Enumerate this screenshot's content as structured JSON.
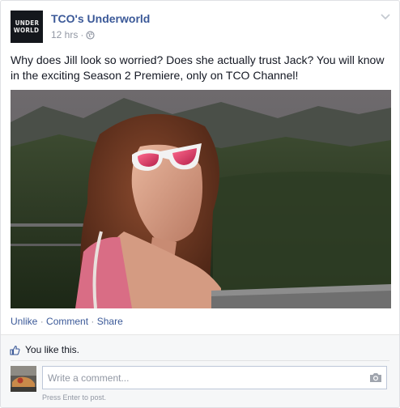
{
  "post": {
    "page_name": "TCO's Underworld",
    "avatar_text_line1": "UNDER",
    "avatar_text_line2": "WORLD",
    "timestamp": "12 hrs",
    "meta_separator": "·",
    "privacy_icon": "globe-icon",
    "text": "Why does Jill look so worried? Does she actually trust Jack? You will know in the exciting Season 2 Premiere, only on TCO Channel!",
    "photo_icon": "photo-woman-sunglasses"
  },
  "actions": {
    "unlike": "Unlike",
    "sep": "·",
    "comment": "Comment",
    "share": "Share"
  },
  "ufi": {
    "likes_text": "You like this.",
    "comment_placeholder": "Write a comment...",
    "hint": "Press Enter to post."
  },
  "colors": {
    "link": "#3b5998",
    "meta": "#9197a3",
    "ufi_bg": "#f6f7f8",
    "text": "#141823"
  }
}
